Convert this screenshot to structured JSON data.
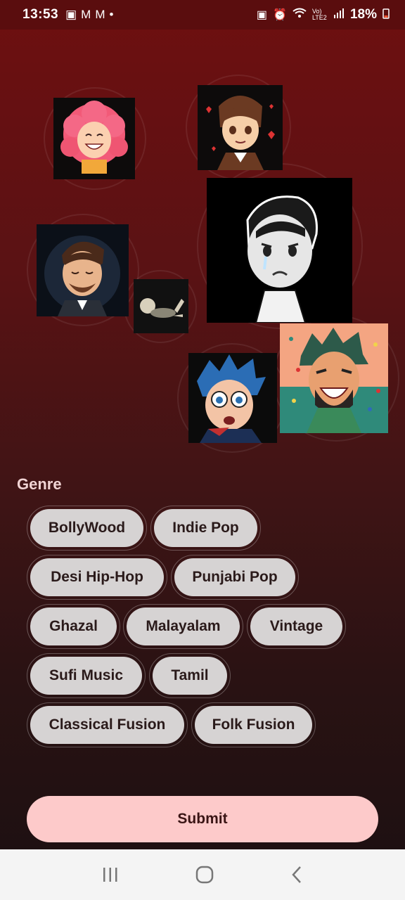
{
  "status": {
    "time": "13:53",
    "left_icons": [
      "image-icon",
      "gmail-icon",
      "gmail-icon",
      "dot-icon"
    ],
    "right_icons": [
      "battery-saver-icon",
      "alarm-icon",
      "wifi-icon",
      "volte-icon",
      "signal-icon"
    ],
    "volte_text": "Vo) LTE2",
    "battery": "18%"
  },
  "moods": [
    {
      "name": "happy-curly-avatar"
    },
    {
      "name": "love-avatar"
    },
    {
      "name": "sad-crying-avatar"
    },
    {
      "name": "calm-avatar"
    },
    {
      "name": "lazy-lying-avatar"
    },
    {
      "name": "shocked-avatar"
    },
    {
      "name": "excited-laughing-avatar"
    }
  ],
  "genre": {
    "title": "Genre",
    "chips": [
      "BollyWood",
      "Indie Pop",
      "Desi Hip-Hop",
      "Punjabi Pop",
      "Ghazal",
      "Malayalam",
      "Vintage",
      "Sufi Music",
      "Tamil",
      "Classical Fusion",
      "Folk Fusion"
    ]
  },
  "submit_label": "Submit",
  "colors": {
    "accent": "#fdcaca",
    "chip_bg": "#d6d3d3",
    "background_top": "#6e0f10",
    "background_bottom": "#1b1011"
  }
}
